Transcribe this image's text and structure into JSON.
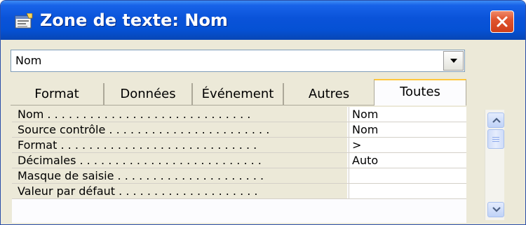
{
  "window": {
    "title": "Zone de texte: Nom"
  },
  "selector": {
    "value": "Nom"
  },
  "tabs": [
    {
      "label": "Format",
      "active": false
    },
    {
      "label": "Données",
      "active": false
    },
    {
      "label": "Événement",
      "active": false
    },
    {
      "label": "Autres",
      "active": false
    },
    {
      "label": "Toutes",
      "active": true
    }
  ],
  "properties": [
    {
      "label": "Nom . . . . . . . . . . . . . . . . . . . . . . . . . . . . .",
      "value": "Nom"
    },
    {
      "label": "Source contrôle . . . . . . . . . . . . . . . . . . . . . . .",
      "value": "Nom"
    },
    {
      "label": "Format . . . . . . . . . . . . . . . . . . . . . . . . . . . .",
      "value": ">"
    },
    {
      "label": "Décimales . . . . . . . . . . . . . . . . . . . . . . . . . .",
      "value": "Auto"
    },
    {
      "label": "Masque de saisie . . . . . . . . . . . . . . . . . . . . .",
      "value": ""
    },
    {
      "label": "Valeur par défaut . . . . . . . . . . . . . . . . . . . .",
      "value": ""
    }
  ],
  "icons": {
    "title": "properties-sheet-icon",
    "close": "close-icon",
    "dropdown": "chevron-down-icon",
    "scroll_up": "arrow-up-icon",
    "scroll_down": "arrow-down-icon"
  },
  "colors": {
    "titlebar": "#0551d4",
    "close_button": "#e0542e",
    "active_tab_highlight": "#ffc73c"
  }
}
